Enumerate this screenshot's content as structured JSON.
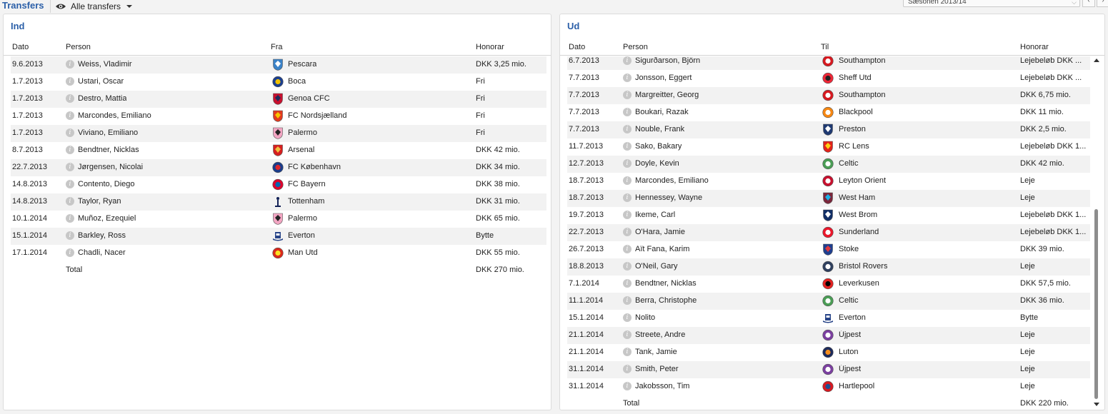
{
  "page": {
    "title": "Transfers",
    "view_filter": "Alle transfers",
    "season": "Sæsonen 2013/14"
  },
  "colors": {
    "accent": "#2b5fa8",
    "alt_row": "#f2f2f2"
  },
  "incoming": {
    "title": "Ind",
    "columns": {
      "date": "Dato",
      "person": "Person",
      "club": "Fra",
      "fee": "Honorar"
    },
    "rows": [
      {
        "date": "9.6.2013",
        "person": "Weiss, Vladimir",
        "club": "Pescara",
        "fee": "DKK 3,25 mio.",
        "crest": "pescara-crest",
        "c1": "#3a82c8",
        "c2": "#ffffff",
        "shape": "shield"
      },
      {
        "date": "1.7.2013",
        "person": "Ustari, Oscar",
        "club": "Boca",
        "fee": "Fri",
        "crest": "boca-crest",
        "c1": "#1c3f8e",
        "c2": "#f2c200",
        "shape": "round"
      },
      {
        "date": "1.7.2013",
        "person": "Destro, Mattia",
        "club": "Genoa CFC",
        "fee": "Fri",
        "crest": "genoa-crest",
        "c1": "#c8102e",
        "c2": "#1c2c5b",
        "shape": "shield"
      },
      {
        "date": "1.7.2013",
        "person": "Marcondes, Emiliano",
        "club": "FC Nordsjælland",
        "fee": "Fri",
        "crest": "nordsjaelland-crest",
        "c1": "#e23a1f",
        "c2": "#f7c600",
        "shape": "shield"
      },
      {
        "date": "1.7.2013",
        "person": "Viviano, Emiliano",
        "club": "Palermo",
        "fee": "Fri",
        "crest": "palermo-crest",
        "c1": "#f3a6c3",
        "c2": "#222222",
        "shape": "shield"
      },
      {
        "date": "8.7.2013",
        "person": "Bendtner, Nicklas",
        "club": "Arsenal",
        "fee": "DKK 42 mio.",
        "crest": "arsenal-crest",
        "c1": "#d61f1f",
        "c2": "#f0c040",
        "shape": "shield"
      },
      {
        "date": "22.7.2013",
        "person": "Jørgensen, Nicolai",
        "club": "FC København",
        "fee": "DKK 34 mio.",
        "crest": "fck-crest",
        "c1": "#1a3c8a",
        "c2": "#e0262b",
        "shape": "round"
      },
      {
        "date": "14.8.2013",
        "person": "Contento, Diego",
        "club": "FC Bayern",
        "fee": "DKK 38 mio.",
        "crest": "bayern-crest",
        "c1": "#dc052d",
        "c2": "#0066b2",
        "shape": "round"
      },
      {
        "date": "14.8.2013",
        "person": "Taylor, Ryan",
        "club": "Tottenham",
        "fee": "DKK 31 mio.",
        "crest": "tottenham-crest",
        "c1": "#132257",
        "c2": "#ffffff",
        "shape": "cockerel"
      },
      {
        "date": "10.1.2014",
        "person": "Muñoz, Ezequiel",
        "club": "Palermo",
        "fee": "DKK 65 mio.",
        "crest": "palermo-crest",
        "c1": "#f3a6c3",
        "c2": "#222222",
        "shape": "shield"
      },
      {
        "date": "15.1.2014",
        "person": "Barkley, Ross",
        "club": "Everton",
        "fee": "Bytte",
        "crest": "everton-crest",
        "c1": "#274488",
        "c2": "#ffffff",
        "shape": "tower"
      },
      {
        "date": "17.1.2014",
        "person": "Chadli, Nacer",
        "club": "Man Utd",
        "fee": "DKK 55 mio.",
        "crest": "manutd-crest",
        "c1": "#da291c",
        "c2": "#fbe122",
        "shape": "round"
      }
    ],
    "total_label": "Total",
    "total_fee": "DKK 270 mio."
  },
  "outgoing": {
    "title": "Ud",
    "columns": {
      "date": "Dato",
      "person": "Person",
      "club": "Til",
      "fee": "Honorar"
    },
    "rows": [
      {
        "date": "6.7.2013",
        "person": "Sigurðarson, Björn",
        "club": "Southampton",
        "fee": "Lejebeløb DKK ...",
        "crest": "southampton-crest",
        "c1": "#d71920",
        "c2": "#ffffff",
        "shape": "round"
      },
      {
        "date": "7.7.2013",
        "person": "Jonsson, Eggert",
        "club": "Sheff Utd",
        "fee": "Lejebeløb DKK ...",
        "crest": "sheffutd-crest",
        "c1": "#ee2737",
        "c2": "#222222",
        "shape": "round"
      },
      {
        "date": "7.7.2013",
        "person": "Margreitter, Georg",
        "club": "Southampton",
        "fee": "DKK 6,75 mio.",
        "crest": "southampton-crest",
        "c1": "#d71920",
        "c2": "#ffffff",
        "shape": "round"
      },
      {
        "date": "7.7.2013",
        "person": "Boukari, Razak",
        "club": "Blackpool",
        "fee": "DKK 11 mio.",
        "crest": "blackpool-crest",
        "c1": "#f68712",
        "c2": "#ffffff",
        "shape": "round"
      },
      {
        "date": "7.7.2013",
        "person": "Nouble, Frank",
        "club": "Preston",
        "fee": "DKK 2,5 mio.",
        "crest": "preston-crest",
        "c1": "#1f3a72",
        "c2": "#ffffff",
        "shape": "shield"
      },
      {
        "date": "11.7.2013",
        "person": "Sako, Bakary",
        "club": "RC Lens",
        "fee": "Lejebeløb DKK 1...",
        "crest": "lens-crest",
        "c1": "#e2231a",
        "c2": "#fcd116",
        "shape": "shield"
      },
      {
        "date": "12.7.2013",
        "person": "Doyle, Kevin",
        "club": "Celtic",
        "fee": "DKK 42 mio.",
        "crest": "celtic-crest",
        "c1": "#4a9d55",
        "c2": "#ffffff",
        "shape": "round"
      },
      {
        "date": "18.7.2013",
        "person": "Marcondes, Emiliano",
        "club": "Leyton Orient",
        "fee": "Leje",
        "crest": "orient-crest",
        "c1": "#c8102e",
        "c2": "#ffffff",
        "shape": "round"
      },
      {
        "date": "18.7.2013",
        "person": "Hennessey, Wayne",
        "club": "West Ham",
        "fee": "Leje",
        "crest": "westham-crest",
        "c1": "#7a263a",
        "c2": "#1bb1e7",
        "shape": "shield"
      },
      {
        "date": "19.7.2013",
        "person": "Ikeme, Carl",
        "club": "West Brom",
        "fee": "Lejebeløb DKK 1...",
        "crest": "westbrom-crest",
        "c1": "#122f67",
        "c2": "#ffffff",
        "shape": "shield"
      },
      {
        "date": "22.7.2013",
        "person": "O'Hara, Jamie",
        "club": "Sunderland",
        "fee": "Lejebeløb DKK 1...",
        "crest": "sunderland-crest",
        "c1": "#eb172b",
        "c2": "#ffffff",
        "shape": "round"
      },
      {
        "date": "26.7.2013",
        "person": "Aït Fana, Karim",
        "club": "Stoke",
        "fee": "DKK 39 mio.",
        "crest": "stoke-crest",
        "c1": "#1f3f8f",
        "c2": "#e03a3e",
        "shape": "shield"
      },
      {
        "date": "18.8.2013",
        "person": "O'Neil, Gary",
        "club": "Bristol Rovers",
        "fee": "Leje",
        "crest": "bristol-crest",
        "c1": "#2f3f5e",
        "c2": "#ffffff",
        "shape": "round"
      },
      {
        "date": "7.1.2014",
        "person": "Bendtner, Nicklas",
        "club": "Leverkusen",
        "fee": "DKK 57,5 mio.",
        "crest": "leverkusen-crest",
        "c1": "#e32221",
        "c2": "#000000",
        "shape": "round"
      },
      {
        "date": "11.1.2014",
        "person": "Berra, Christophe",
        "club": "Celtic",
        "fee": "DKK 36 mio.",
        "crest": "celtic-crest",
        "c1": "#4a9d55",
        "c2": "#ffffff",
        "shape": "round"
      },
      {
        "date": "15.1.2014",
        "person": "Nolito",
        "club": "Everton",
        "fee": "Bytte",
        "crest": "everton-crest",
        "c1": "#274488",
        "c2": "#ffffff",
        "shape": "tower"
      },
      {
        "date": "21.1.2014",
        "person": "Streete, Andre",
        "club": "Újpest",
        "fee": "Leje",
        "crest": "ujpest-crest",
        "c1": "#7b3fa0",
        "c2": "#ffffff",
        "shape": "round"
      },
      {
        "date": "21.1.2014",
        "person": "Tank, Jamie",
        "club": "Luton",
        "fee": "Leje",
        "crest": "luton-crest",
        "c1": "#1d2b5c",
        "c2": "#f78f1e",
        "shape": "round"
      },
      {
        "date": "31.1.2014",
        "person": "Smith, Peter",
        "club": "Újpest",
        "fee": "Leje",
        "crest": "ujpest-crest",
        "c1": "#7b3fa0",
        "c2": "#ffffff",
        "shape": "round"
      },
      {
        "date": "31.1.2014",
        "person": "Jakobsson, Tim",
        "club": "Hartlepool",
        "fee": "Leje",
        "crest": "hartlepool-crest",
        "c1": "#d71920",
        "c2": "#1d4f91",
        "shape": "round"
      }
    ],
    "total_label": "Total",
    "total_fee": "DKK 220 mio."
  }
}
